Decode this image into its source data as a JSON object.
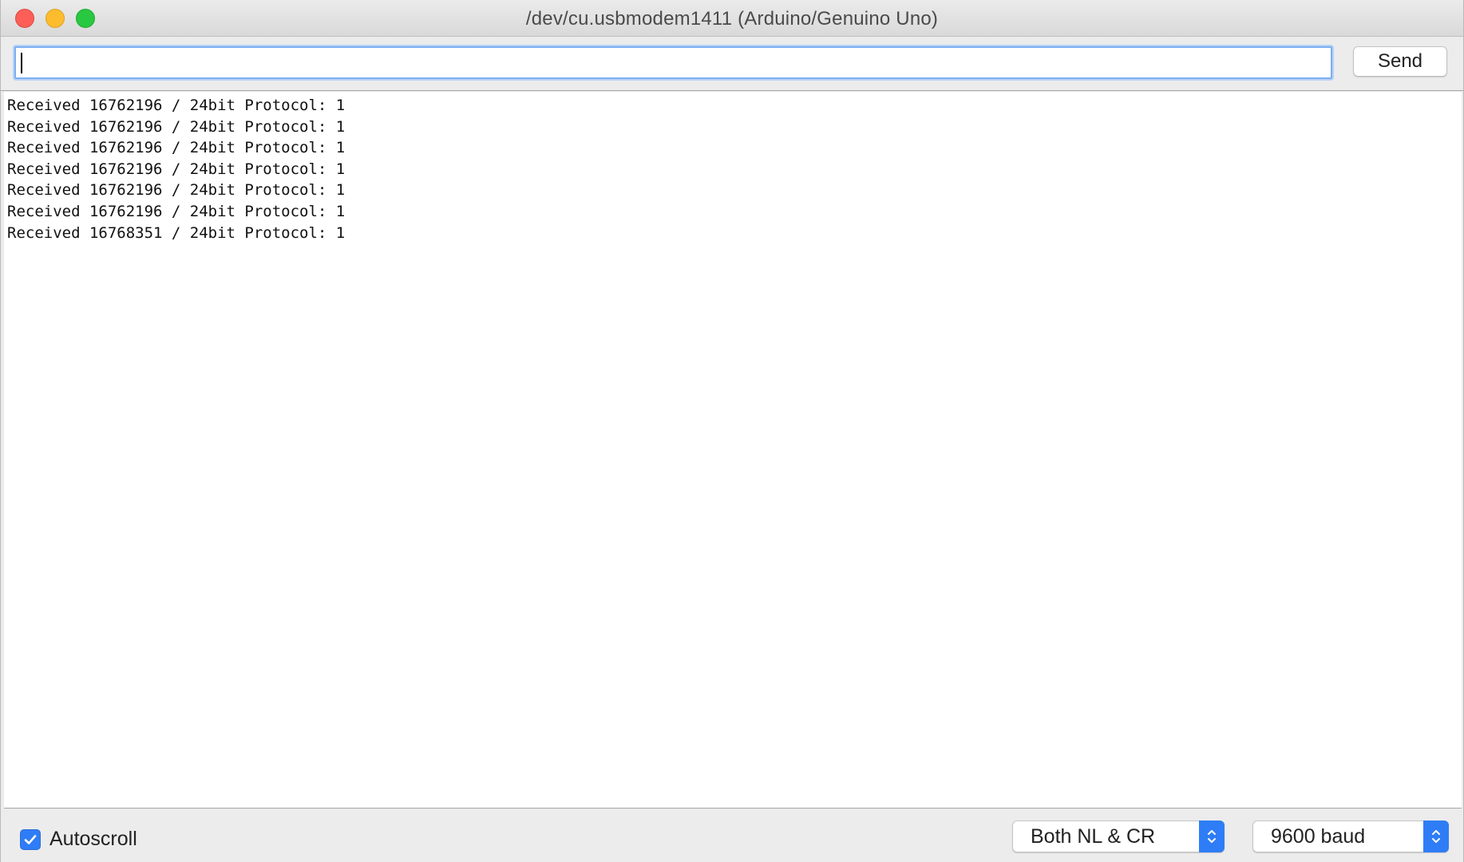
{
  "window": {
    "title": "/dev/cu.usbmodem1411 (Arduino/Genuino Uno)"
  },
  "toolbar": {
    "input_value": "",
    "send_label": "Send"
  },
  "output": {
    "lines": [
      "Received 16762196 / 24bit Protocol: 1",
      "Received 16762196 / 24bit Protocol: 1",
      "Received 16762196 / 24bit Protocol: 1",
      "Received 16762196 / 24bit Protocol: 1",
      "Received 16762196 / 24bit Protocol: 1",
      "Received 16762196 / 24bit Protocol: 1",
      "Received 16768351 / 24bit Protocol: 1"
    ]
  },
  "status": {
    "autoscroll_label": "Autoscroll",
    "autoscroll_checked": true,
    "line_ending": "Both NL & CR",
    "baud_rate": "9600 baud"
  },
  "colors": {
    "accent": "#2f7df6",
    "close": "#fc5f57",
    "minimize": "#fdbc2e",
    "maximize": "#28c840"
  },
  "icons": [
    "close-icon",
    "minimize-icon",
    "maximize-icon",
    "checkmark-icon",
    "chevron-updown-icon"
  ]
}
